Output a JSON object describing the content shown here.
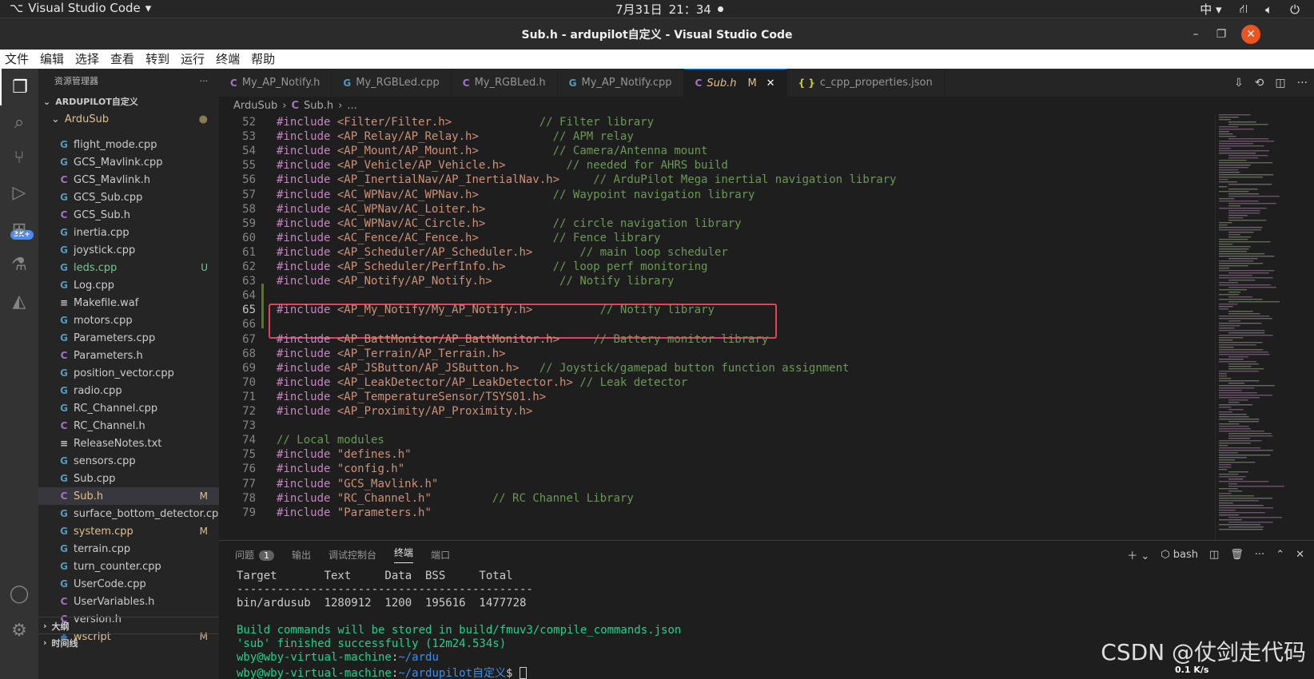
{
  "os": {
    "app_label": "Visual Studio Code",
    "date": "7月31日",
    "time": "21：34",
    "ime": "中"
  },
  "window": {
    "title": "Sub.h - ardupilot自定义 - Visual Studio Code"
  },
  "menu": [
    "文件",
    "编辑",
    "选择",
    "查看",
    "转到",
    "运行",
    "终端",
    "帮助"
  ],
  "activity": {
    "badge": "3K+"
  },
  "explorer": {
    "title": "资源管理器",
    "more": "···",
    "root": "ARDUPILOT自定义",
    "folder": "ArduSub",
    "files": [
      {
        "name": "flight_mode.cpp",
        "type": "cpp",
        "status": ""
      },
      {
        "name": "GCS_Mavlink.cpp",
        "type": "cpp",
        "status": ""
      },
      {
        "name": "GCS_Mavlink.h",
        "type": "c",
        "status": ""
      },
      {
        "name": "GCS_Sub.cpp",
        "type": "cpp",
        "status": ""
      },
      {
        "name": "GCS_Sub.h",
        "type": "c",
        "status": ""
      },
      {
        "name": "inertia.cpp",
        "type": "cpp",
        "status": ""
      },
      {
        "name": "joystick.cpp",
        "type": "cpp",
        "status": ""
      },
      {
        "name": "leds.cpp",
        "type": "cpp",
        "status": "U"
      },
      {
        "name": "Log.cpp",
        "type": "cpp",
        "status": ""
      },
      {
        "name": "Makefile.waf",
        "type": "txt",
        "status": ""
      },
      {
        "name": "motors.cpp",
        "type": "cpp",
        "status": ""
      },
      {
        "name": "Parameters.cpp",
        "type": "cpp",
        "status": ""
      },
      {
        "name": "Parameters.h",
        "type": "c",
        "status": ""
      },
      {
        "name": "position_vector.cpp",
        "type": "cpp",
        "status": ""
      },
      {
        "name": "radio.cpp",
        "type": "cpp",
        "status": ""
      },
      {
        "name": "RC_Channel.cpp",
        "type": "cpp",
        "status": ""
      },
      {
        "name": "RC_Channel.h",
        "type": "c",
        "status": ""
      },
      {
        "name": "ReleaseNotes.txt",
        "type": "txt",
        "status": ""
      },
      {
        "name": "sensors.cpp",
        "type": "cpp",
        "status": ""
      },
      {
        "name": "Sub.cpp",
        "type": "cpp",
        "status": ""
      },
      {
        "name": "Sub.h",
        "type": "c",
        "status": "M"
      },
      {
        "name": "surface_bottom_detector.cpp",
        "type": "cpp",
        "status": ""
      },
      {
        "name": "system.cpp",
        "type": "cpp",
        "status": "M"
      },
      {
        "name": "terrain.cpp",
        "type": "cpp",
        "status": ""
      },
      {
        "name": "turn_counter.cpp",
        "type": "cpp",
        "status": ""
      },
      {
        "name": "UserCode.cpp",
        "type": "cpp",
        "status": ""
      },
      {
        "name": "UserVariables.h",
        "type": "c",
        "status": ""
      },
      {
        "name": "version.h",
        "type": "c",
        "status": ""
      },
      {
        "name": "wscript",
        "type": "py",
        "status": "M"
      }
    ],
    "outline": "大纲",
    "timeline": "时间线"
  },
  "tabs": [
    {
      "label": "My_AP_Notify.h",
      "type": "c",
      "active": false,
      "modified": ""
    },
    {
      "label": "My_RGBLed.cpp",
      "type": "cpp",
      "active": false,
      "modified": ""
    },
    {
      "label": "My_RGBLed.h",
      "type": "c",
      "active": false,
      "modified": ""
    },
    {
      "label": "My_AP_Notify.cpp",
      "type": "cpp",
      "active": false,
      "modified": ""
    },
    {
      "label": "Sub.h",
      "type": "c",
      "active": true,
      "modified": "M"
    },
    {
      "label": "c_cpp_properties.json",
      "type": "json",
      "active": false,
      "modified": ""
    }
  ],
  "breadcrumb": [
    "ArduSub",
    "Sub.h",
    "..."
  ],
  "code": [
    {
      "n": "52",
      "kw": "#include",
      "path": "<Filter/Filter.h>",
      "pad": "             ",
      "comment": "// Filter library"
    },
    {
      "n": "53",
      "kw": "#include",
      "path": "<AP_Relay/AP_Relay.h>",
      "pad": "           ",
      "comment": "// APM relay"
    },
    {
      "n": "54",
      "kw": "#include",
      "path": "<AP_Mount/AP_Mount.h>",
      "pad": "           ",
      "comment": "// Camera/Antenna mount"
    },
    {
      "n": "55",
      "kw": "#include",
      "path": "<AP_Vehicle/AP_Vehicle.h>",
      "pad": "         ",
      "comment": "// needed for AHRS build"
    },
    {
      "n": "56",
      "kw": "#include",
      "path": "<AP_InertialNav/AP_InertialNav.h>",
      "pad": "     ",
      "comment": "// ArduPilot Mega inertial navigation library"
    },
    {
      "n": "57",
      "kw": "#include",
      "path": "<AC_WPNav/AC_WPNav.h>",
      "pad": "           ",
      "comment": "// Waypoint navigation library"
    },
    {
      "n": "58",
      "kw": "#include",
      "path": "<AC_WPNav/AC_Loiter.h>",
      "pad": "",
      "comment": ""
    },
    {
      "n": "59",
      "kw": "#include",
      "path": "<AC_WPNav/AC_Circle.h>",
      "pad": "          ",
      "comment": "// circle navigation library"
    },
    {
      "n": "60",
      "kw": "#include",
      "path": "<AC_Fence/AC_Fence.h>",
      "pad": "           ",
      "comment": "// Fence library"
    },
    {
      "n": "61",
      "kw": "#include",
      "path": "<AP_Scheduler/AP_Scheduler.h>",
      "pad": "       ",
      "comment": "// main loop scheduler"
    },
    {
      "n": "62",
      "kw": "#include",
      "path": "<AP_Scheduler/PerfInfo.h>",
      "pad": "       ",
      "comment": "// loop perf monitoring"
    },
    {
      "n": "63",
      "kw": "#include",
      "path": "<AP_Notify/AP_Notify.h>",
      "pad": "          ",
      "comment": "// Notify library"
    },
    {
      "n": "64",
      "kw": "",
      "path": "",
      "pad": "",
      "comment": ""
    },
    {
      "n": "65",
      "kw": "#include",
      "path": "<AP_My_Notify/My_AP_Notify.h>",
      "pad": "          ",
      "comment": "// Notify library"
    },
    {
      "n": "66",
      "kw": "",
      "path": "",
      "pad": "",
      "comment": ""
    },
    {
      "n": "67",
      "kw": "#include",
      "path": "<AP_BattMonitor/AP_BattMonitor.h>",
      "pad": "     ",
      "comment": "// Battery monitor library"
    },
    {
      "n": "68",
      "kw": "#include",
      "path": "<AP_Terrain/AP_Terrain.h>",
      "pad": "",
      "comment": ""
    },
    {
      "n": "69",
      "kw": "#include",
      "path": "<AP_JSButton/AP_JSButton.h>",
      "pad": "   ",
      "comment": "// Joystick/gamepad button function assignment"
    },
    {
      "n": "70",
      "kw": "#include",
      "path": "<AP_LeakDetector/AP_LeakDetector.h>",
      "pad": " ",
      "comment": "// Leak detector"
    },
    {
      "n": "71",
      "kw": "#include",
      "path": "<AP_TemperatureSensor/TSYS01.h>",
      "pad": "",
      "comment": ""
    },
    {
      "n": "72",
      "kw": "#include",
      "path": "<AP_Proximity/AP_Proximity.h>",
      "pad": "",
      "comment": ""
    },
    {
      "n": "73",
      "kw": "",
      "path": "",
      "pad": "",
      "comment": ""
    },
    {
      "n": "74",
      "kw": "",
      "path": "",
      "pad": "",
      "comment": "// Local modules"
    },
    {
      "n": "75",
      "kw": "#include",
      "path": "\"defines.h\"",
      "pad": "",
      "comment": ""
    },
    {
      "n": "76",
      "kw": "#include",
      "path": "\"config.h\"",
      "pad": "",
      "comment": ""
    },
    {
      "n": "77",
      "kw": "#include",
      "path": "\"GCS_Mavlink.h\"",
      "pad": "",
      "comment": ""
    },
    {
      "n": "78",
      "kw": "#include",
      "path": "\"RC_Channel.h\"",
      "pad": "         ",
      "comment": "// RC Channel Library"
    },
    {
      "n": "79",
      "kw": "#include",
      "path": "\"Parameters.h\"",
      "pad": "",
      "comment": ""
    }
  ],
  "panel": {
    "tabs": [
      "问题",
      "输出",
      "调试控制台",
      "终端",
      "端口"
    ],
    "problems_count": "1",
    "active_tab": "终端",
    "shell": "bash",
    "terminal": {
      "header": "Target       Text     Data  BSS     Total",
      "rule": "--------------------------------------------",
      "row": "bin/ardusub  1280912  1200  195616  1477728",
      "build_msg": "Build commands will be stored in build/fmuv3/compile_commands.json",
      "finish_msg": "'sub' finished successfully (12m24.534s)",
      "prompt1_user": "wby@wby-virtual-machine",
      "prompt1_path": "~/ardu",
      "prompt2_user": "wby@wby-virtual-machine",
      "prompt2_path": "~/ardupilot自定义",
      "prompt2_suffix": "$ "
    }
  },
  "overlay": {
    "watermark": "CSDN @仗剑走代码",
    "netspeed": "0.1 K/s"
  }
}
